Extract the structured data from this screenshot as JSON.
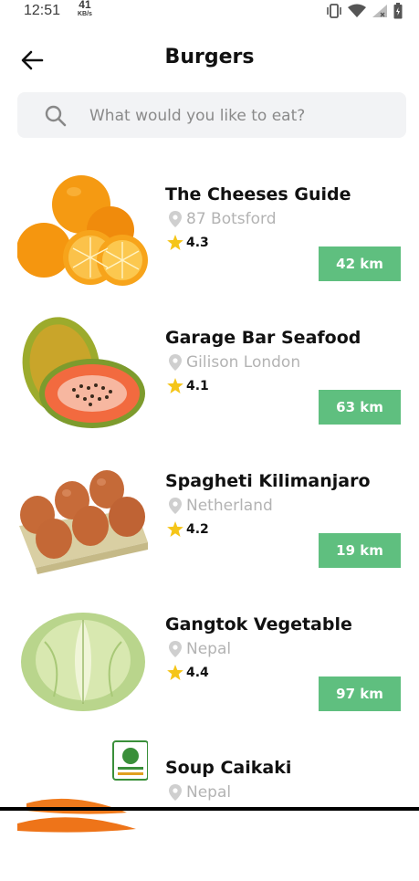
{
  "status_bar": {
    "time": "12:51",
    "speed_value": "41",
    "speed_unit": "KB/s"
  },
  "header": {
    "title": "Burgers"
  },
  "search": {
    "placeholder": "What would you like to eat?"
  },
  "items": [
    {
      "name": "The Cheeses Guide",
      "location": "87 Botsford",
      "rating": "4.3",
      "distance": "42 km",
      "image": "oranges"
    },
    {
      "name": "Garage Bar Seafood",
      "location": "Gilison London",
      "rating": "4.1",
      "distance": "63 km",
      "image": "papaya"
    },
    {
      "name": "Spagheti Kilimanjaro",
      "location": "Netherland",
      "rating": "4.2",
      "distance": "19 km",
      "image": "eggs"
    },
    {
      "name": "Gangtok Vegetable",
      "location": "Nepal",
      "rating": "4.4",
      "distance": "97 km",
      "image": "cabbage"
    },
    {
      "name": "Soup Caikaki",
      "location": "Nepal",
      "rating": "",
      "distance": "",
      "image": "carrots"
    }
  ],
  "colors": {
    "accent_green": "#5fbf7f",
    "star_yellow": "#f5c518",
    "muted_text": "#b3b3b3",
    "search_bg": "#f2f3f5"
  }
}
